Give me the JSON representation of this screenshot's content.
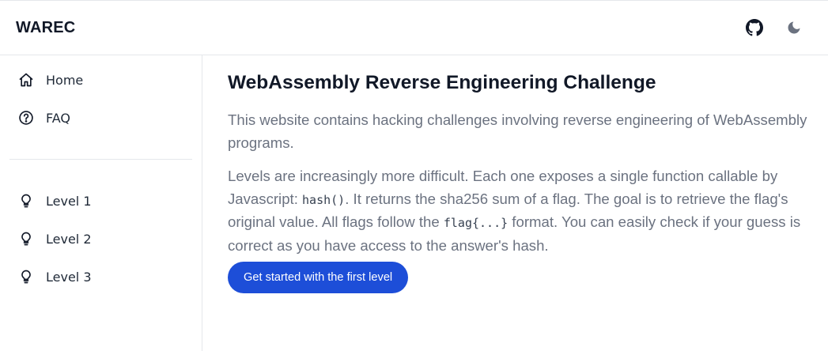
{
  "header": {
    "brand": "WAREC",
    "github_icon": "github-icon",
    "theme_icon": "moon-icon"
  },
  "sidebar": {
    "items": [
      {
        "label": "Home",
        "icon": "home-icon"
      },
      {
        "label": "FAQ",
        "icon": "question-circle-icon"
      }
    ],
    "levels": [
      {
        "label": "Level 1",
        "icon": "lightbulb-icon"
      },
      {
        "label": "Level 2",
        "icon": "lightbulb-icon"
      },
      {
        "label": "Level 3",
        "icon": "lightbulb-icon"
      }
    ]
  },
  "main": {
    "title": "WebAssembly Reverse Engineering Challenge",
    "intro": "This website contains hacking challenges involving reverse engineering of WebAssembly programs.",
    "levels_text_1": "Levels are increasingly more difficult. Each one exposes a single function callable by Javascript: ",
    "levels_code_1": "hash()",
    "levels_text_2": ". It returns the sha256 sum of a flag. The goal is to retrieve the flag's original value. All flags follow the ",
    "levels_code_2": "flag{...}",
    "levels_text_3": " format. You can easily check if your guess is correct as you have access to the answer's hash.",
    "cta_label": "Get started with the first level"
  },
  "colors": {
    "accent": "#1d4ed8",
    "muted_text": "#6b7280",
    "border": "#e5e7eb"
  }
}
